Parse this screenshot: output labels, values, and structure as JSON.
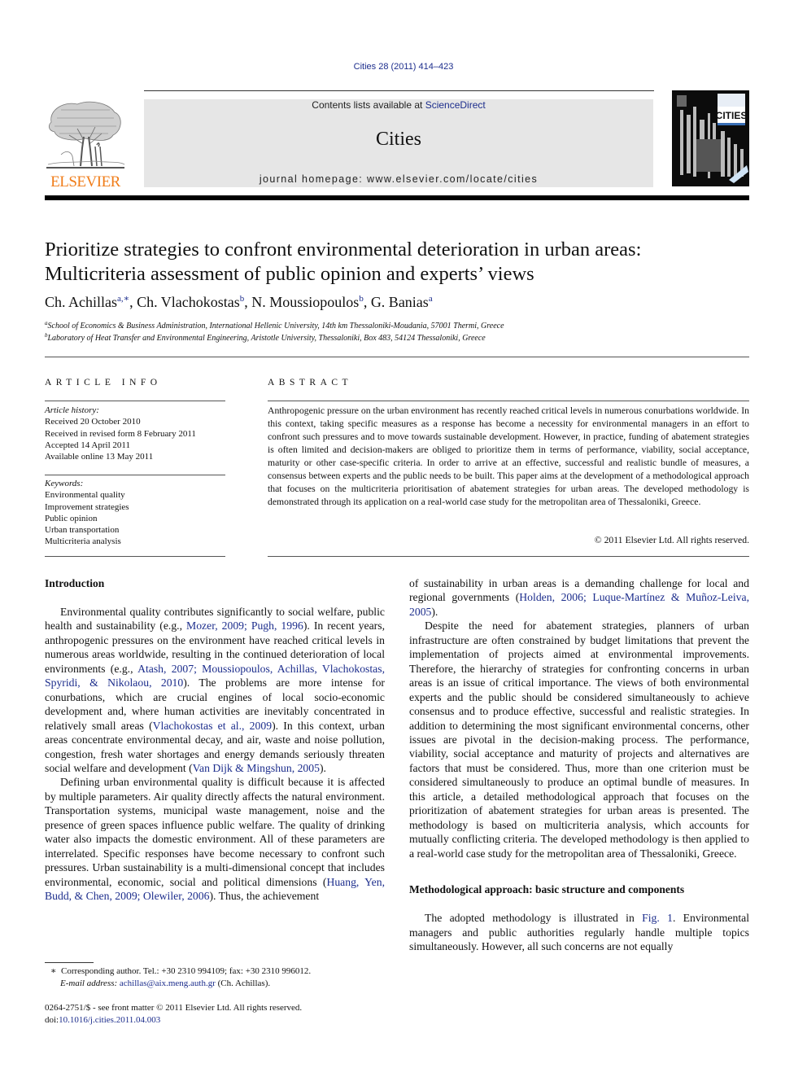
{
  "journal_ref": "Cities 28 (2011) 414–423",
  "header": {
    "publisher_logo_text": "ELSEVIER",
    "contents_prefix": "Contents lists available at ",
    "contents_link": "ScienceDirect",
    "journal_name": "Cities",
    "homepage": "journal homepage: www.elsevier.com/locate/cities",
    "cover_title": "CITIES",
    "colors": {
      "elsevier_orange": "#f07d1a",
      "link_blue": "#1c2d8c",
      "banner_gray": "#e6e6e6"
    }
  },
  "article": {
    "title_line1": "Prioritize strategies to confront environmental deterioration in urban areas:",
    "title_line2": "Multicriteria assessment of public opinion and experts’ views",
    "authors": [
      {
        "name": "Ch. Achillas",
        "sup": "a,∗"
      },
      {
        "name": "Ch. Vlachokostas",
        "sup": "b"
      },
      {
        "name": "N. Moussiopoulos",
        "sup": "b"
      },
      {
        "name": "G. Banias",
        "sup": "a"
      }
    ],
    "affiliations": [
      {
        "mark": "a",
        "text": "School of Economics & Business Administration, International Hellenic University, 14th km Thessaloniki-Moudania, 57001 Thermi, Greece"
      },
      {
        "mark": "b",
        "text": "Laboratory of Heat Transfer and Environmental Engineering, Aristotle University, Thessaloniki, Box 483, 54124 Thessaloniki, Greece"
      }
    ]
  },
  "article_info": {
    "heading": "ARTICLE INFO",
    "history_label": "Article history:",
    "history": [
      "Received 20 October 2010",
      "Received in revised form 8 February 2011",
      "Accepted 14 April 2011",
      "Available online 13 May 2011"
    ],
    "keywords_label": "Keywords:",
    "keywords": [
      "Environmental quality",
      "Improvement strategies",
      "Public opinion",
      "Urban transportation",
      "Multicriteria analysis"
    ]
  },
  "abstract": {
    "heading": "ABSTRACT",
    "text": "Anthropogenic pressure on the urban environment has recently reached critical levels in numerous conurbations worldwide. In this context, taking specific measures as a response has become a necessity for environmental managers in an effort to confront such pressures and to move towards sustainable development. However, in practice, funding of abatement strategies is often limited and decision-makers are obliged to prioritize them in terms of performance, viability, social acceptance, maturity or other case-specific criteria. In order to arrive at an effective, successful and realistic bundle of measures, a consensus between experts and the public needs to be built. This paper aims at the development of a methodological approach that focuses on the multicriteria prioritisation of abatement strategies for urban areas. The developed methodology is demonstrated through its application on a real-world case study for the metropolitan area of Thessaloniki, Greece.",
    "copyright": "© 2011 Elsevier Ltd. All rights reserved."
  },
  "body": {
    "intro_heading": "Introduction",
    "p1": [
      {
        "t": "Environmental quality contributes significantly to social welfare, public health and sustainability (e.g., "
      },
      {
        "l": "Mozer, 2009; Pugh, 1996"
      },
      {
        "t": "). In recent years, anthropogenic pressures on the environment have reached critical levels in numerous areas worldwide, resulting in the continued deterioration of local environments (e.g., "
      },
      {
        "l": "Atash, 2007; Moussiopoulos, Achillas, Vlachokostas, Spyridi, & Nikolaou, 2010"
      },
      {
        "t": "). The problems are more intense for conurbations, which are crucial engines of local socio-economic development and, where human activities are inevitably concentrated in relatively small areas ("
      },
      {
        "l": "Vlachokostas et al., 2009"
      },
      {
        "t": "). In this context, urban areas concentrate environmental decay, and air, waste and noise pollution, congestion, fresh water shortages and energy demands seriously threaten social welfare and development ("
      },
      {
        "l": "Van Dijk & Mingshun, 2005"
      },
      {
        "t": ")."
      }
    ],
    "p2": [
      {
        "t": "Defining urban environmental quality is difficult because it is affected by multiple parameters. Air quality directly affects the natural environment. Transportation systems, municipal waste management, noise and the presence of green spaces influence public welfare. The quality of drinking water also impacts the domestic environment. All of these parameters are interrelated. Specific responses have become necessary to confront such pressures. Urban sustainability is a multi-dimensional concept that includes environmental, economic, social and political dimensions ("
      },
      {
        "l": "Huang, Yen, Budd, & Chen, 2009; Olewiler, 2006"
      },
      {
        "t": "). Thus, the achievement"
      }
    ],
    "p2_cont": [
      {
        "t": "of sustainability in urban areas is a demanding challenge for local and regional governments ("
      },
      {
        "l": "Holden, 2006; Luque-Martínez & Muñoz-Leiva, 2005"
      },
      {
        "t": ")."
      }
    ],
    "p3": [
      {
        "t": "Despite the need for abatement strategies, planners of urban infrastructure are often constrained by budget limitations that prevent the implementation of projects aimed at environmental improvements. Therefore, the hierarchy of strategies for confronting concerns in urban areas is an issue of critical importance. The views of both environmental experts and the public should be considered simultaneously to achieve consensus and to produce effective, successful and realistic strategies. In addition to determining the most significant environmental concerns, other issues are pivotal in the decision-making process. The performance, viability, social acceptance and maturity of projects and alternatives are factors that must be considered. Thus, more than one criterion must be considered simultaneously to produce an optimal bundle of measures. In this article, a detailed methodological approach that focuses on the prioritization of abatement strategies for urban areas is presented. The methodology is based on multicriteria analysis, which accounts for mutually conflicting criteria. The developed methodology is then applied to a real-world case study for the metropolitan area of Thessaloniki, Greece."
      }
    ],
    "method_heading": "Methodological approach: basic structure and components",
    "p4": [
      {
        "t": "The adopted methodology is illustrated in "
      },
      {
        "l": "Fig. 1"
      },
      {
        "t": ". Environmental managers and public authorities regularly handle multiple topics simultaneously. However, all such concerns are not equally"
      }
    ]
  },
  "footnote": {
    "mark": "∗",
    "text": "Corresponding author. Tel.: +30 2310 994109; fax: +30 2310 996012.",
    "email_label": "E-mail address:",
    "email": "achillas@aix.meng.auth.gr",
    "email_suffix": " (Ch. Achillas)."
  },
  "issn": {
    "line": "0264-2751/$ - see front matter © 2011 Elsevier Ltd. All rights reserved.",
    "doi_prefix": "doi:",
    "doi": "10.1016/j.cities.2011.04.003"
  }
}
